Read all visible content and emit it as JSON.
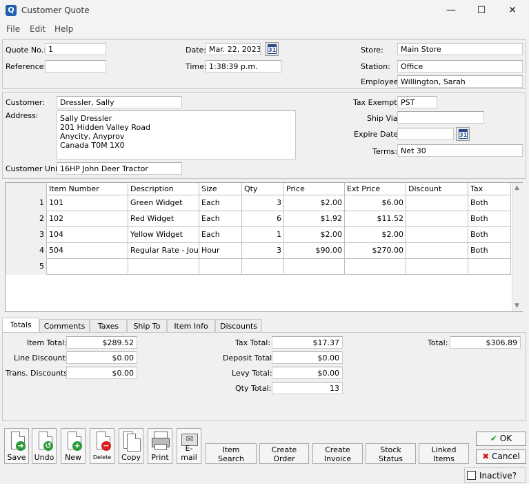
{
  "window": {
    "title": "Customer Quote",
    "minimize": "—",
    "maximize": "☐",
    "close": "✕"
  },
  "menu": [
    "File",
    "Edit",
    "Help"
  ],
  "header": {
    "quote_no_label": "Quote No.:",
    "quote_no": "1",
    "reference_label": "Reference:",
    "reference": "",
    "date_label": "Date:",
    "date": "Mar. 22, 2023",
    "time_label": "Time:",
    "time": "1:38:39 p.m.",
    "calendar_day": "31",
    "store_label": "Store:",
    "store": "Main Store",
    "station_label": "Station:",
    "station": "Office",
    "employee_label": "Employee:",
    "employee": "Willington, Sarah"
  },
  "customer": {
    "customer_label": "Customer:",
    "customer": "Dressler, Sally",
    "address_label": "Address:",
    "address": [
      "Sally Dressler",
      "201 Hidden Valley Road",
      "Anycity, Anyprov",
      "Canada  T0M 1X0"
    ],
    "unit_label": "Customer Unit:",
    "unit": "16HP John Deer Tractor",
    "tax_exempt_label": "Tax Exempt:",
    "tax_exempt": "PST",
    "ship_via_label": "Ship Via:",
    "ship_via": "",
    "expire_label": "Expire Date:",
    "expire": "",
    "terms_label": "Terms:",
    "terms": "Net 30"
  },
  "grid": {
    "columns": [
      "Item Number",
      "Description",
      "Size",
      "Qty",
      "Price",
      "Ext Price",
      "Discount",
      "Tax"
    ],
    "rows": [
      {
        "n": "1",
        "item": "101",
        "desc": "Green Widget",
        "size": "Each",
        "qty": "3",
        "price": "$2.00",
        "ext": "$6.00",
        "disc": "",
        "tax": "Both"
      },
      {
        "n": "2",
        "item": "102",
        "desc": "Red Widget",
        "size": "Each",
        "qty": "6",
        "price": "$1.92",
        "ext": "$11.52",
        "disc": "",
        "tax": "Both"
      },
      {
        "n": "3",
        "item": "104",
        "desc": "Yellow Widget",
        "size": "Each",
        "qty": "1",
        "price": "$2.00",
        "ext": "$2.00",
        "disc": "",
        "tax": "Both"
      },
      {
        "n": "4",
        "item": "504",
        "desc": "Regular Rate - Journeyman",
        "size": "Hour",
        "qty": "3",
        "price": "$90.00",
        "ext": "$270.00",
        "disc": "",
        "tax": "Both"
      },
      {
        "n": "5",
        "item": "",
        "desc": "",
        "size": "",
        "qty": "",
        "price": "",
        "ext": "",
        "disc": "",
        "tax": ""
      }
    ]
  },
  "tabs": [
    "Totals",
    "Comments",
    "Taxes",
    "Ship To",
    "Item Info",
    "Discounts"
  ],
  "totals": {
    "item_total_label": "Item Total:",
    "item_total": "$289.52",
    "line_disc_label": "Line Discounts:",
    "line_disc": "$0.00",
    "trans_disc_label": "Trans. Discounts:",
    "trans_disc": "$0.00",
    "tax_total_label": "Tax Total:",
    "tax_total": "$17.37",
    "deposit_label": "Deposit Total:",
    "deposit": "$0.00",
    "levy_label": "Levy Total:",
    "levy": "$0.00",
    "qty_label": "Qty Total:",
    "qty": "13",
    "total_label": "Total:",
    "total": "$306.89"
  },
  "toolbar": {
    "save": "Save",
    "undo": "Undo",
    "new": "New",
    "delete": "Delete",
    "copy": "Copy",
    "print": "Print",
    "email": "E-mail",
    "item_search_1": "Item",
    "item_search_2": "Search",
    "create_order_1": "Create",
    "create_order_2": "Order",
    "create_invoice_1": "Create",
    "create_invoice_2": "Invoice",
    "stock_status_1": "Stock",
    "stock_status_2": "Status",
    "linked_items_1": "Linked",
    "linked_items_2": "Items",
    "ok": "OK",
    "cancel": "Cancel",
    "inactive": "Inactive?"
  },
  "colors": {
    "ok_check": "#1a9e1a",
    "cancel_x": "#d01e1e",
    "app_icon": "#1f5fae"
  }
}
